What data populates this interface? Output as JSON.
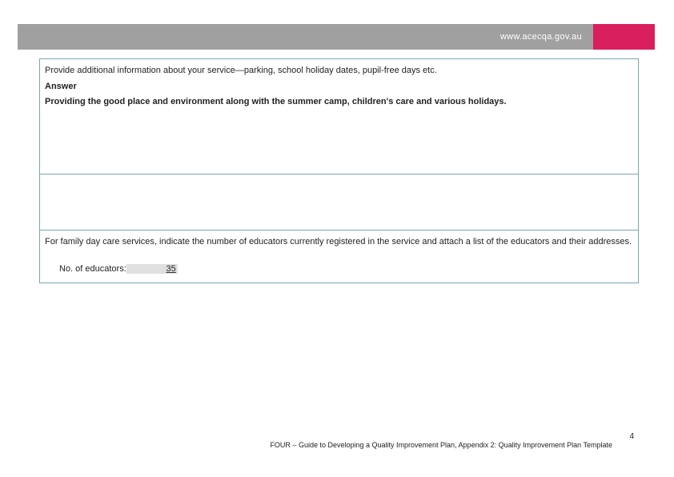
{
  "header": {
    "url": "www.acecqa.gov.au"
  },
  "section1": {
    "prompt": "Provide additional information about your service—parking, school holiday dates, pupil-free days etc.",
    "answer_label": "Answer",
    "answer_text": "Providing the good place and environment along with the summer camp, children's care and various holidays."
  },
  "section3": {
    "prompt": "For family day care services, indicate the number of educators currently registered in the service and attach a list of the educators and their addresses.",
    "educators_label": "No. of educators:",
    "educators_value": "               35     "
  },
  "footer": {
    "page_number": "4",
    "text": "FOUR – Guide to Developing a Quality Improvement Plan, Appendix 2: Quality Improvement Plan Template"
  }
}
